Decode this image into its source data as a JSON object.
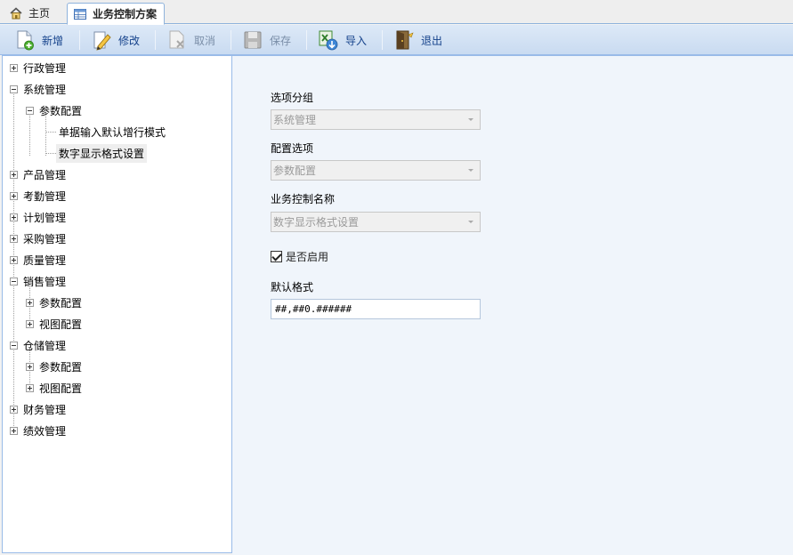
{
  "tabs": {
    "home_label": "主页",
    "active_label": "业务控制方案"
  },
  "toolbar": {
    "new_label": "新增",
    "edit_label": "修改",
    "cancel_label": "取消",
    "save_label": "保存",
    "import_label": "导入",
    "exit_label": "退出"
  },
  "tree": {
    "n0": "行政管理",
    "n1": "系统管理",
    "n2": "参数配置",
    "n3": "单据输入默认增行模式",
    "n4": "数字显示格式设置",
    "n5": "产品管理",
    "n6": "考勤管理",
    "n7": "计划管理",
    "n8": "采购管理",
    "n9": "质量管理",
    "n10": "销售管理",
    "n11": "参数配置",
    "n12": "视图配置",
    "n13": "仓储管理",
    "n14": "参数配置",
    "n15": "视图配置",
    "n16": "财务管理",
    "n17": "绩效管理"
  },
  "form": {
    "group_label": "选项分组",
    "group_value": "系统管理",
    "option_label": "配置选项",
    "option_value": "参数配置",
    "control_name_label": "业务控制名称",
    "control_name_value": "数字显示格式设置",
    "enabled_label": "是否启用",
    "enabled": true,
    "default_format_label": "默认格式",
    "default_format_value": "##,##0.######"
  },
  "colors": {
    "toolbar_text": "#15428b",
    "panel_border": "#99bbe8",
    "form_background": "#f0f5fb"
  }
}
